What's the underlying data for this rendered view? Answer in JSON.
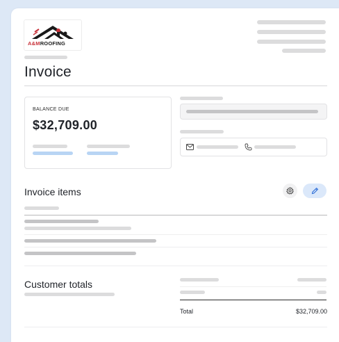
{
  "logo": {
    "brand_prefix": "A&M",
    "brand_suffix": "ROOFING"
  },
  "invoice": {
    "title": "Invoice"
  },
  "balance": {
    "label": "BALANCE DUE",
    "value": "$32,709.00"
  },
  "items_section": {
    "title": "Invoice items"
  },
  "totals_section": {
    "title": "Customer totals",
    "total_label": "Total",
    "total_value": "$32,709.00"
  },
  "icons": {
    "settings": "gear-icon",
    "edit": "pencil-icon",
    "email": "envelope-icon",
    "phone": "phone-icon"
  },
  "colors": {
    "background": "#dde8f6",
    "accent": "#2f6fd8",
    "logo_red": "#c8323a"
  }
}
